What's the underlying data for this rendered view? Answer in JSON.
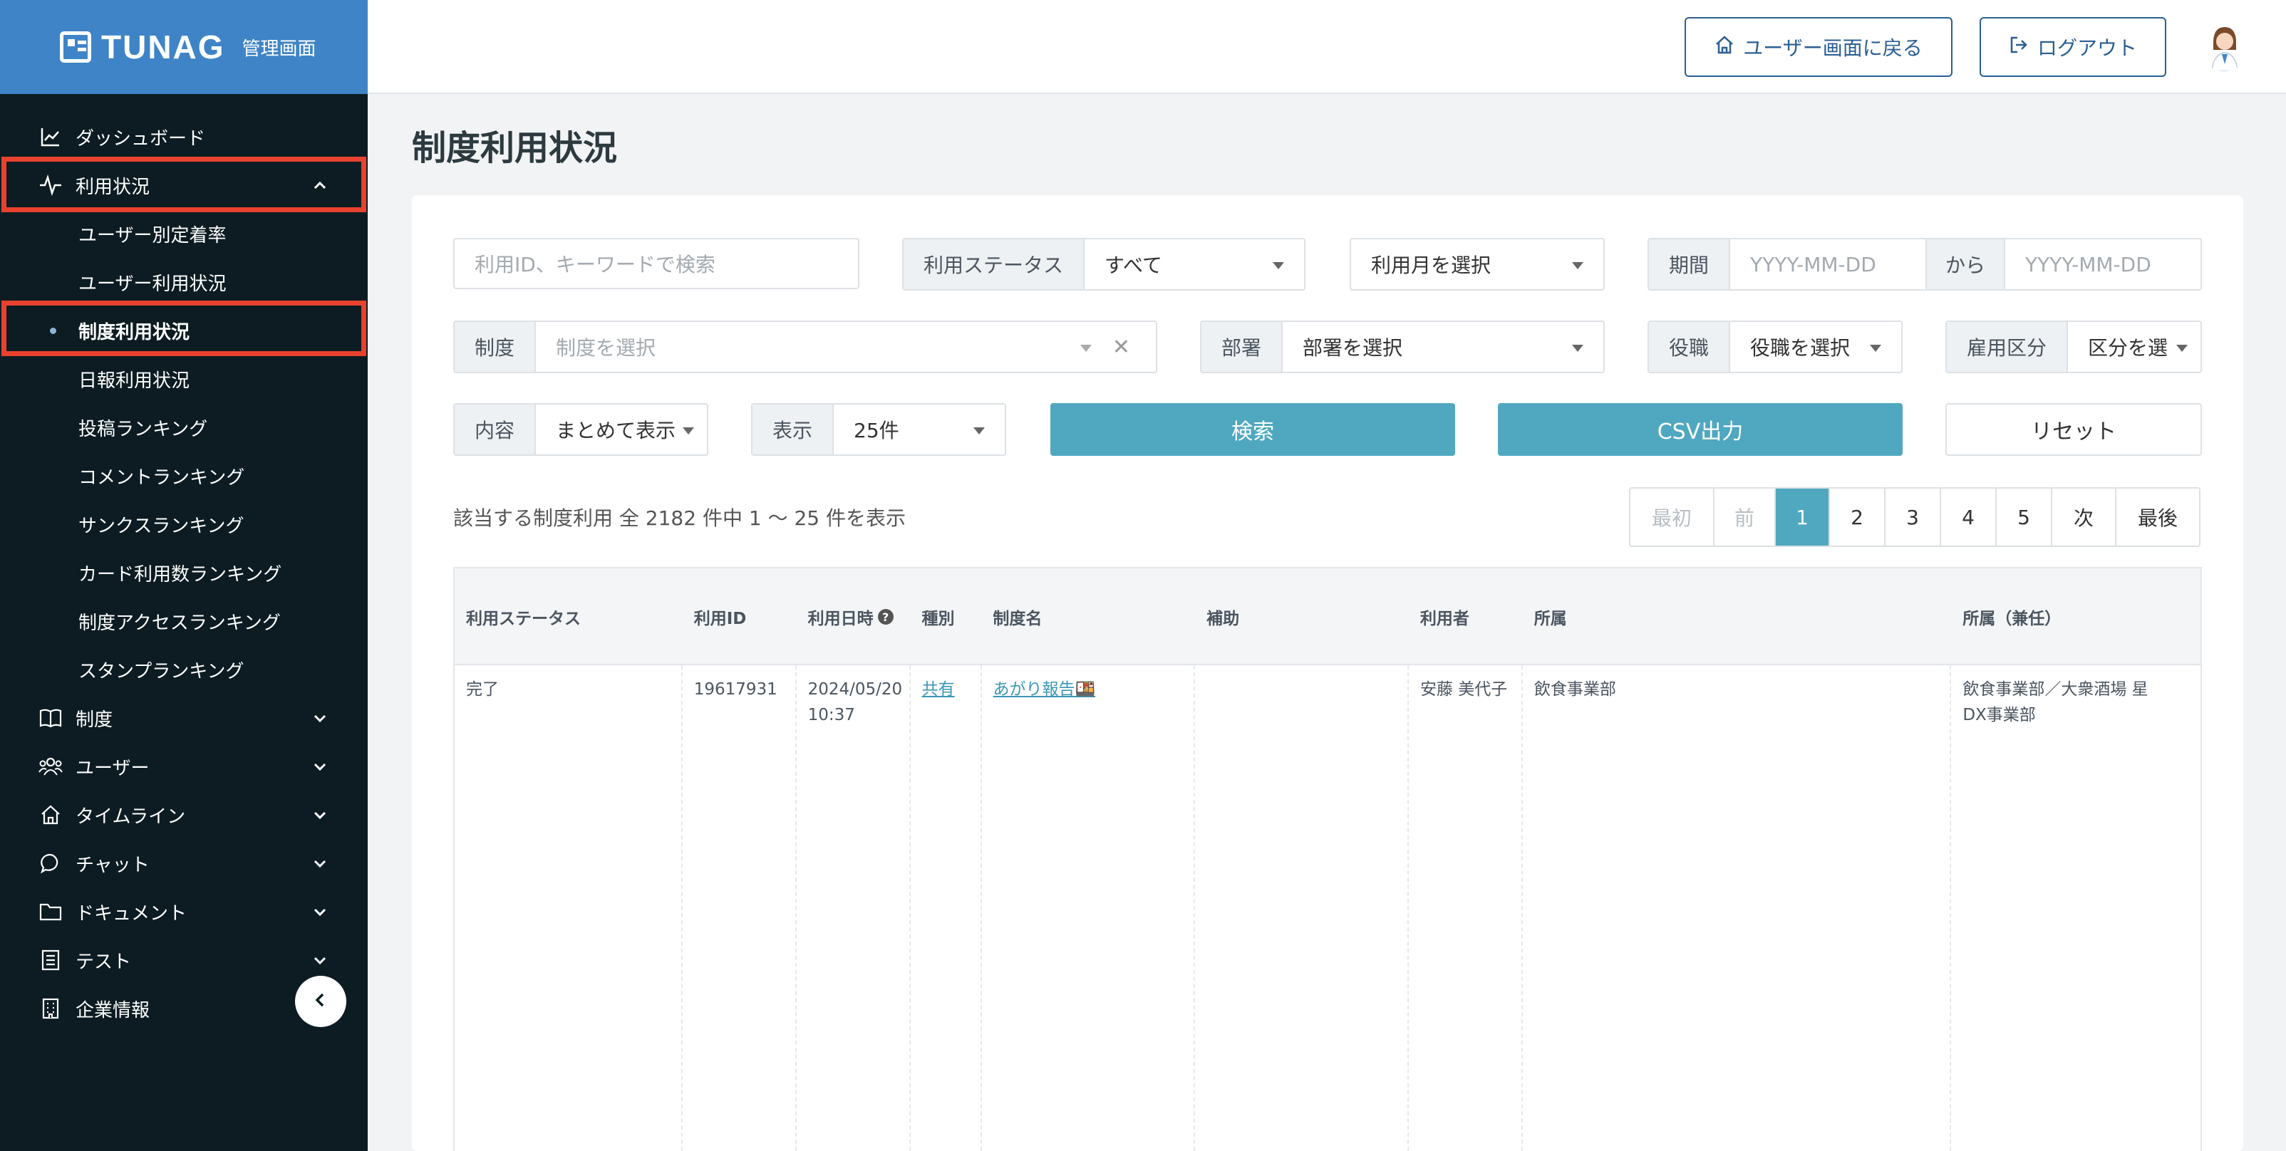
{
  "brand": {
    "name": "TUNAG",
    "subtitle": "管理画面"
  },
  "sidebar": {
    "top_items": [
      {
        "label": "ダッシュボード",
        "icon": "chart-icon"
      },
      {
        "label": "利用状況",
        "icon": "activity-icon"
      }
    ],
    "sub_items": [
      {
        "label": "ユーザー別定着率"
      },
      {
        "label": "ユーザー利用状況"
      },
      {
        "label": "制度利用状況"
      },
      {
        "label": "日報利用状況"
      },
      {
        "label": "投稿ランキング"
      },
      {
        "label": "コメントランキング"
      },
      {
        "label": "サンクスランキング"
      },
      {
        "label": "カード利用数ランキング"
      },
      {
        "label": "制度アクセスランキング"
      },
      {
        "label": "スタンプランキング"
      }
    ],
    "bottom_items": [
      {
        "label": "制度",
        "icon": "book-icon"
      },
      {
        "label": "ユーザー",
        "icon": "users-icon"
      },
      {
        "label": "タイムライン",
        "icon": "home-icon"
      },
      {
        "label": "チャット",
        "icon": "chat-icon"
      },
      {
        "label": "ドキュメント",
        "icon": "folder-icon"
      },
      {
        "label": "テスト",
        "icon": "test-icon"
      },
      {
        "label": "企業情報",
        "icon": "building-icon"
      }
    ],
    "highlight_color": "#e8422f"
  },
  "header": {
    "back_label": "ユーザー画面に戻る",
    "logout_label": "ログアウト"
  },
  "page": {
    "title": "制度利用状況"
  },
  "filters": {
    "keyword_placeholder": "利用ID、キーワードで検索",
    "status_label": "利用ステータス",
    "status_value": "すべて",
    "month_placeholder": "利用月を選択",
    "period_label": "期間",
    "period_from_placeholder": "YYYY-MM-DD",
    "period_sep": "から",
    "period_to_placeholder": "YYYY-MM-DD",
    "system_label": "制度",
    "system_placeholder": "制度を選択",
    "dept_label": "部署",
    "dept_placeholder": "部署を選択",
    "position_label": "役職",
    "position_placeholder": "役職を選択",
    "employment_label": "雇用区分",
    "employment_placeholder": "区分を選",
    "content_label": "内容",
    "content_value": "まとめて表示",
    "display_label": "表示",
    "display_value": "25件",
    "search_label": "検索",
    "csv_label": "CSV出力",
    "reset_label": "リセット"
  },
  "results": {
    "summary": "該当する制度利用 全 2182 件中 1 〜 25 件を表示",
    "pagination": [
      "最初",
      "前",
      "1",
      "2",
      "3",
      "4",
      "5",
      "次",
      "最後"
    ],
    "current_page": "1"
  },
  "table": {
    "headers": [
      "利用ステータス",
      "利用ID",
      "利用日時",
      "種別",
      "制度名",
      "補助",
      "利用者",
      "所属",
      "所属（兼任）"
    ],
    "rows": [
      {
        "status": "完了",
        "id": "19617931",
        "datetime": "2024/05/20 10:37",
        "type": "共有",
        "system_name": "あがり報告🍱",
        "assist": "",
        "user": "安藤 美代子",
        "affiliation": "飲食事業部",
        "affiliation_concurrent": "飲食事業部／大衆酒場 星\nDX事業部"
      }
    ]
  },
  "colors": {
    "accent": "#4fa8c0",
    "brand": "#3f84c7",
    "sidebar": "#0d1c22",
    "outline": "#2a5f93"
  }
}
